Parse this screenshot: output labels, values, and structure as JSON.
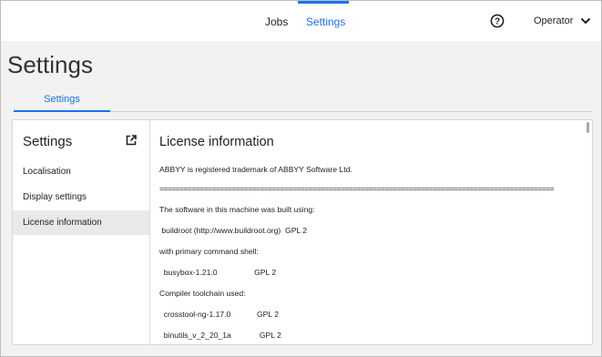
{
  "topbar": {
    "nav_jobs": "Jobs",
    "nav_settings": "Settings",
    "help_icon": "help-circle-icon",
    "user_label": "Operator",
    "menu_icon": "chevron-down-icon"
  },
  "page": {
    "title": "Settings",
    "tabs": [
      {
        "label": "Settings"
      }
    ]
  },
  "sidebar": {
    "title": "Settings",
    "open_icon": "open-external-icon",
    "items": [
      {
        "label": "Localisation"
      },
      {
        "label": "Display settings"
      },
      {
        "label": "License information"
      }
    ]
  },
  "content": {
    "title": "License information",
    "lines": [
      "ABBYY is registered trademark of ABBYY Software Ltd.",
      "==================================================================================================",
      "The software in this machine was built using:",
      " buildroot (http://www.buildroot.org)  GPL 2",
      "with primary command shell:",
      "  busybox-1.21.0                 GPL 2",
      "Compiler toolchain used:",
      "  crosstool-ng-1.17.0            GPL 2",
      "  binutils_v_2_20_1a             GPL 2"
    ]
  },
  "colors": {
    "accent": "#1a73e8",
    "active_item_bg": "#e9e9e9"
  }
}
